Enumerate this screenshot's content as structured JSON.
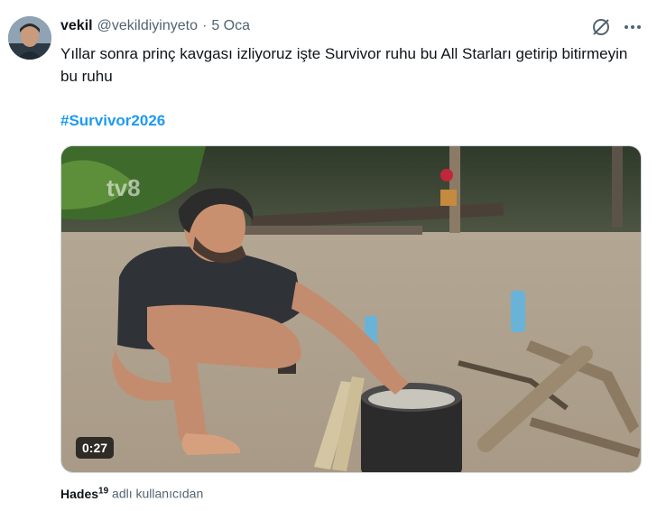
{
  "tweet": {
    "display_name": "vekil",
    "handle": "@vekildiyinyeto",
    "separator": "·",
    "timestamp": "5 Oca",
    "text": "Yıllar sonra prinç kavgası izliyoruz işte Survivor ruhu bu All Starları getirip bitirmeyin bu ruhu",
    "hashtag": "#Survivor2026",
    "icons": [
      "grok-icon",
      "more-icon"
    ]
  },
  "media": {
    "watermark": "tv8",
    "duration": "0:27"
  },
  "attribution": {
    "user": "Hades",
    "user_superscript": "19",
    "suffix": "adlı kullanıcıdan"
  },
  "colors": {
    "link": "#1d9bf0",
    "secondary_text": "#536471",
    "primary_text": "#0f1419"
  }
}
